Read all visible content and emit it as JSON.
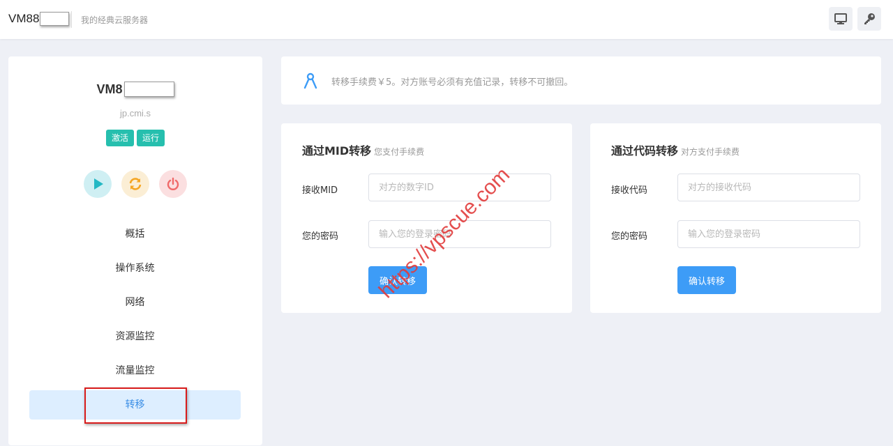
{
  "header": {
    "brand": "VM88",
    "subtitle": "我的经典云服务器",
    "icons": [
      "monitor-icon",
      "key-icon"
    ]
  },
  "server": {
    "name": "VM8",
    "host": "jp.cmi.s",
    "badges": [
      "激活",
      "运行"
    ],
    "actions": [
      "play-icon",
      "restart-icon",
      "power-icon"
    ]
  },
  "nav": {
    "items": [
      "概括",
      "操作系统",
      "网络",
      "资源监控",
      "流量监控",
      "转移"
    ],
    "active_index": 5
  },
  "notice": {
    "text": "转移手续费￥5。对方账号必须有充值记录，转移不可撤回。"
  },
  "mid_transfer": {
    "title": "通过MID转移",
    "subtitle": "您支付手续费",
    "receive_label": "接收MID",
    "receive_placeholder": "对方的数字ID",
    "password_label": "您的密码",
    "password_placeholder": "输入您的登录密码",
    "submit_label": "确认转移"
  },
  "code_transfer": {
    "title": "通过代码转移",
    "subtitle": "对方支付手续费",
    "receive_label": "接收代码",
    "receive_placeholder": "对方的接收代码",
    "password_label": "您的密码",
    "password_placeholder": "输入您的登录密码",
    "submit_label": "确认转移"
  },
  "watermark": "https://vpscue.com",
  "colors": {
    "accent": "#3d9cf7",
    "badge": "#26bfae",
    "nav_active_bg": "#ddeeff",
    "highlight": "#d81b1b"
  }
}
